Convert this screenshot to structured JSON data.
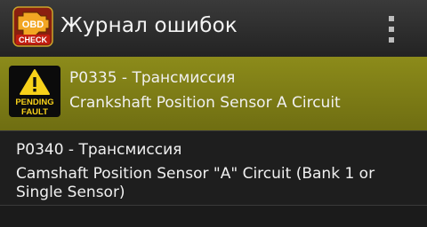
{
  "app": {
    "title": "Журнал ошибок",
    "icon_text_top": "OBD",
    "icon_text_bottom": "CHECK"
  },
  "errors": [
    {
      "code_line": "P0335 - Трансмиссия",
      "description": "Crankshaft Position Sensor A Circuit",
      "status": "PENDING FAULT",
      "selected": true
    },
    {
      "code_line": "P0340 - Трансмиссия",
      "description": "Camshaft Position Sensor \"A\" Circuit (Bank 1 or Single Sensor)",
      "selected": false
    }
  ],
  "colors": {
    "selected_row": "#7d7c16",
    "warning_yellow": "#f7d11a"
  },
  "icons": [
    "obd-check-engine-icon",
    "overflow-menu-icon",
    "warning-triangle-icon"
  ]
}
